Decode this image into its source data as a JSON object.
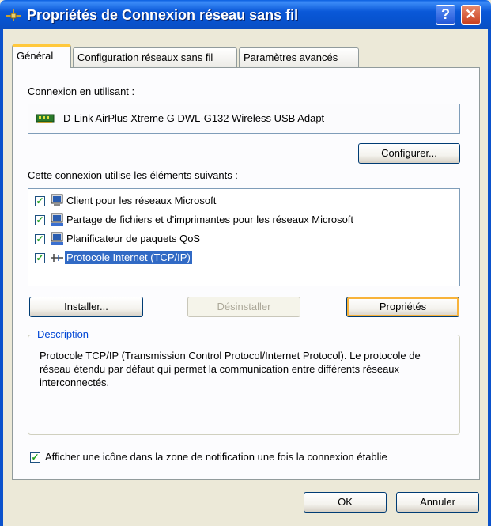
{
  "window": {
    "title": "Propriétés de Connexion réseau sans fil",
    "help_glyph": "?",
    "close_glyph": "✕"
  },
  "tabs": [
    {
      "label": "Général",
      "active": true
    },
    {
      "label": "Configuration réseaux sans fil",
      "active": false
    },
    {
      "label": "Paramètres avancés",
      "active": false
    }
  ],
  "general": {
    "connect_using_label": "Connexion en utilisant :",
    "adapter_name": "D-Link AirPlus Xtreme G DWL-G132 Wireless USB Adapt",
    "configure_button": "Configurer...",
    "items_label": "Cette connexion utilise les éléments suivants :",
    "items": [
      {
        "label": "Client pour les réseaux Microsoft",
        "checked": true,
        "icon": "network-client-icon"
      },
      {
        "label": "Partage de fichiers et d'imprimantes pour les réseaux Microsoft",
        "checked": true,
        "icon": "file-printer-sharing-icon"
      },
      {
        "label": "Planificateur de paquets QoS",
        "checked": true,
        "icon": "qos-scheduler-icon"
      },
      {
        "label": "Protocole Internet (TCP/IP)",
        "checked": true,
        "icon": "protocol-icon",
        "selected": true
      }
    ],
    "install_button": "Installer...",
    "uninstall_button": "Désinstaller",
    "properties_button": "Propriétés",
    "description_title": "Description",
    "description_text": "Protocole TCP/IP (Transmission Control Protocol/Internet Protocol). Le protocole de réseau étendu par défaut qui permet la communication entre différents réseaux interconnectés.",
    "notify_checkbox_label": "Afficher une icône dans la zone de notification une fois la connexion établie",
    "notify_checked": true,
    "check_glyph": "✓"
  },
  "footer": {
    "ok_button": "OK",
    "cancel_button": "Annuler"
  },
  "colors": {
    "title_bar": "#0a58d8",
    "selection": "#316ac5",
    "group_title": "#0046d5",
    "dialog_bg": "#ece9d8"
  }
}
